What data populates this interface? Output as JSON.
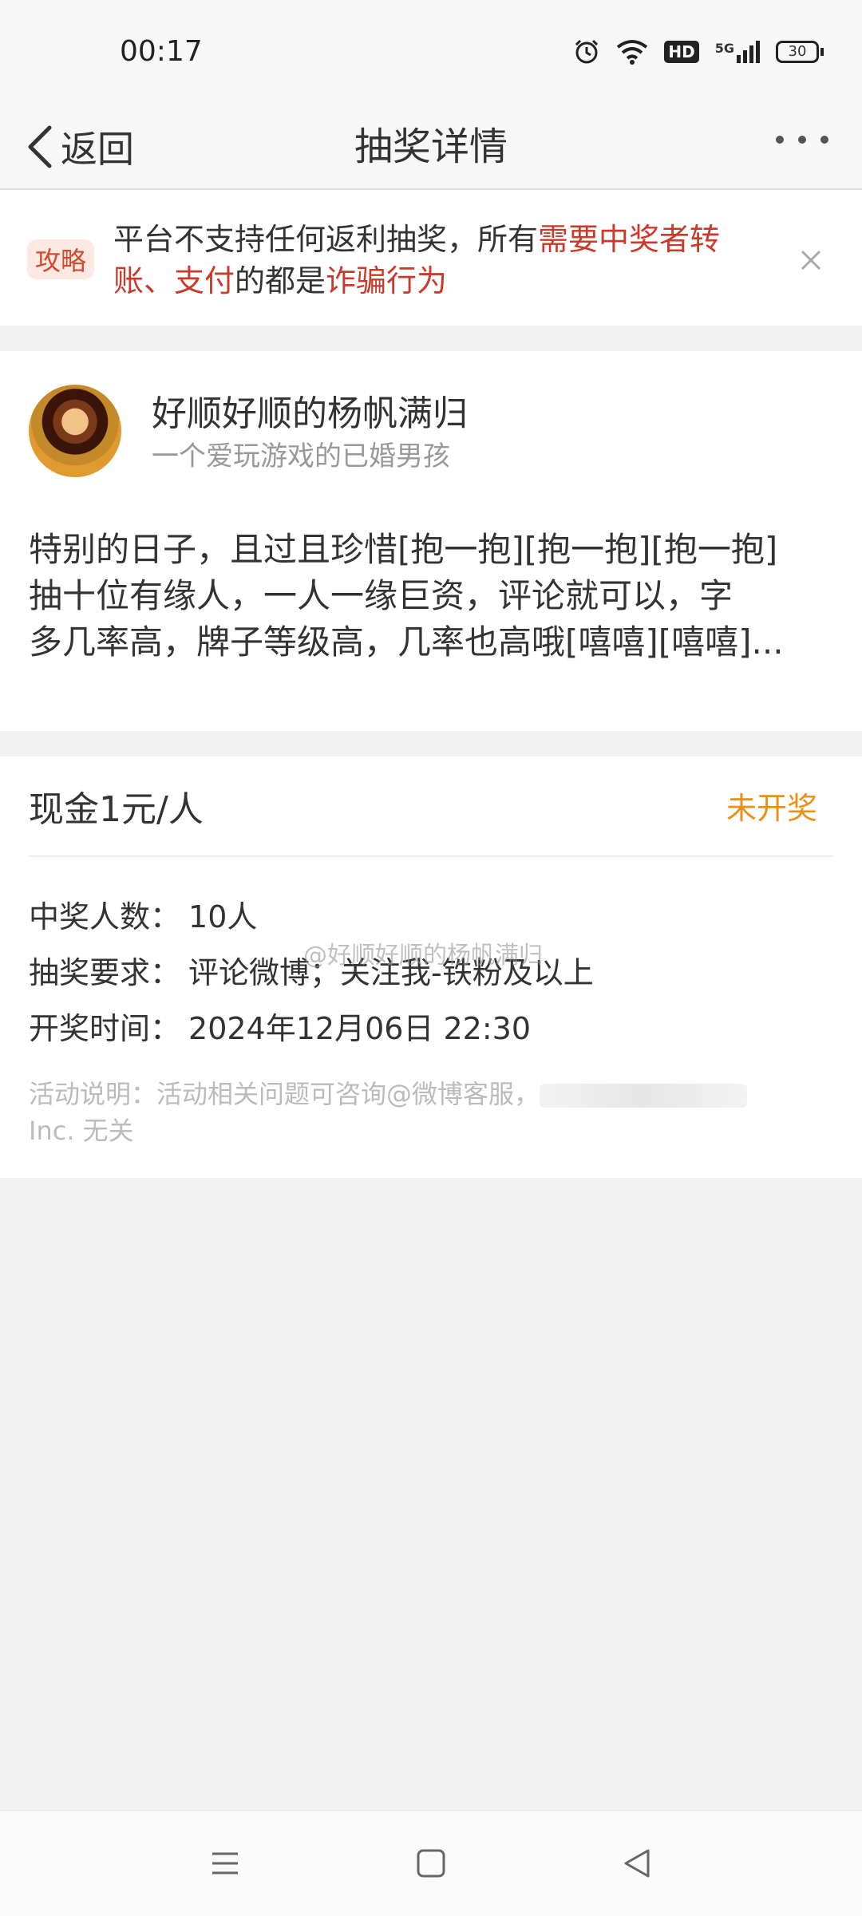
{
  "status_bar": {
    "time": "00:17",
    "icons": [
      "alarm-icon",
      "wifi-icon",
      "hd-icon",
      "5g-signal-icon",
      "battery-icon"
    ],
    "hd_label": "HD",
    "network_label": "5G",
    "battery_level": "30"
  },
  "nav": {
    "back_label": "返回",
    "title": "抽奖详情"
  },
  "notice": {
    "tag": "攻略",
    "text_1": "平台不支持任何返利抽奖，所有",
    "text_highlight_1": "需要中奖者转账、支付",
    "text_2": "的都是",
    "text_highlight_2": "诈骗行为"
  },
  "user": {
    "name": "好顺好顺的杨帆满归",
    "description": "一个爱玩游戏的已婚男孩"
  },
  "post": {
    "line_1": "特别的日子，且过且珍惜[抱一抱][抱一抱][抱一抱]",
    "line_2": "抽十位有缘人，一人一缘巨资，评论就可以，字",
    "line_3": "多几率高，牌子等级高，几率也高哦[嘻嘻][嘻嘻]..."
  },
  "prize": {
    "title": "现金1元/人",
    "status": "未开奖",
    "winners_label": "中奖人数：",
    "winners_value": "10人",
    "requirement_label": "抽奖要求：",
    "requirement_value": "评论微博；关注我-铁粉及以上",
    "time_label": "开奖时间：",
    "time_value": "2024年12月06日 22:30",
    "note_1": "活动说明：活动相关问题可咨询@微博客服，",
    "note_2": "Inc. 无关"
  },
  "watermark": "@好顺好顺的杨帆满归",
  "colors": {
    "highlight": "#c93a2a",
    "status_orange": "#e8901a",
    "background": "#f2f2f2"
  }
}
